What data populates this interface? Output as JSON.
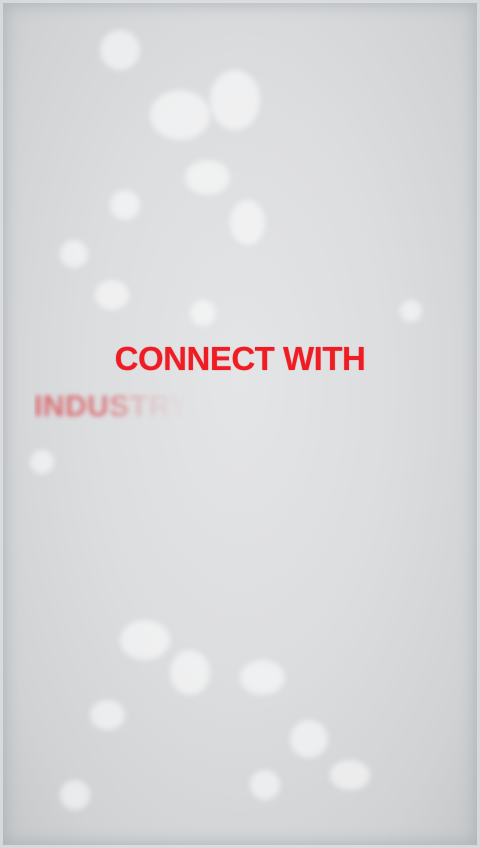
{
  "headline": "CONNECT WITH",
  "subline": "INDUSTRY",
  "colors": {
    "text_accent": "#ef1c24",
    "background": "#dcdddf"
  }
}
